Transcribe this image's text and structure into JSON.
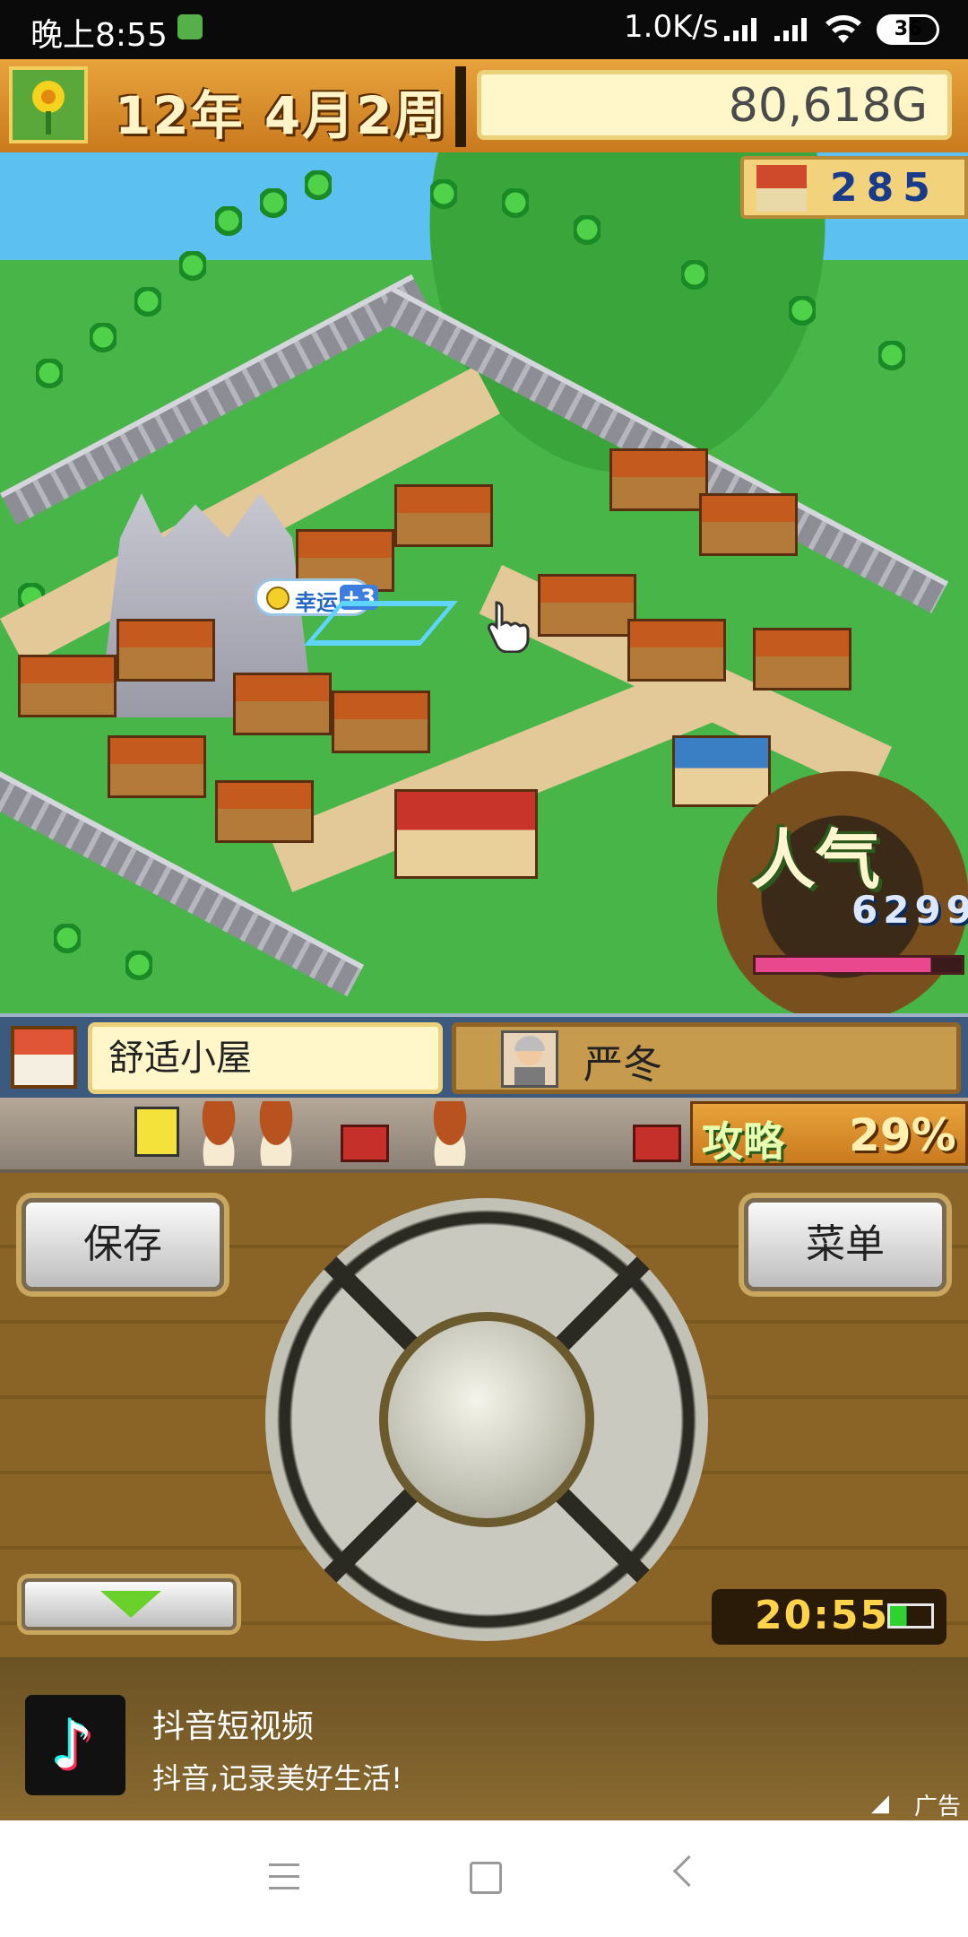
{
  "status_bar": {
    "time": "晚上8:55",
    "network_speed": "1.0K/s",
    "battery": "36"
  },
  "top_bar": {
    "date": "12年 4月2周",
    "money": "80,618G"
  },
  "map": {
    "resident_count": "285",
    "event_bubble_label": "幸运",
    "event_bubble_value": "+3",
    "popularity_label": "人气",
    "popularity_value": "6299",
    "popularity_fill": 0.85
  },
  "info_bar": {
    "facility_name": "舒适小屋",
    "adventurer_name": "严冬"
  },
  "strip": {
    "guide_label": "攻略",
    "guide_percent": "29%"
  },
  "controls": {
    "save_label": "保存",
    "menu_label": "菜单",
    "clock": "20:55"
  },
  "ad": {
    "app_icon": "tiktok-icon",
    "title": "抖音短视频",
    "subtitle": "抖音,记录美好生活!",
    "tag": "广告"
  },
  "colors": {
    "accent_orange": "#e8a33b",
    "panel_cream": "#fff7c9",
    "popularity_pink": "#e9488e"
  }
}
